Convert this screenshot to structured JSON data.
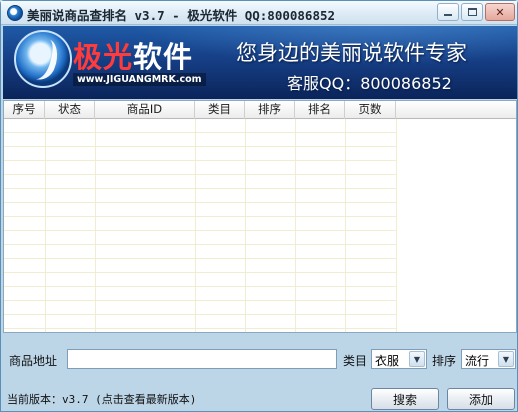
{
  "window": {
    "title": "美丽说商品查排名 v3.7 - 极光软件 QQ:800086852"
  },
  "banner": {
    "brand_part1": "极光",
    "brand_part2": "软件",
    "url": "www.JIGUANGMRK.com",
    "slogan": "您身边的美丽说软件专家",
    "service": "客服QQ：800086852"
  },
  "table": {
    "columns": [
      "序号",
      "状态",
      "商品ID",
      "类目",
      "排序",
      "排名",
      "页数"
    ],
    "rows": []
  },
  "form": {
    "product_url_label": "商品地址",
    "product_url_value": "",
    "category_label": "类目",
    "category_value": "衣服",
    "sort_label": "排序",
    "sort_value": "流行"
  },
  "footer": {
    "version_text": "当前版本：v3.7 (点击查看最新版本)",
    "search_label": "搜索",
    "add_label": "添加"
  },
  "colors": {
    "banner_top": "#1f5aa6",
    "banner_bottom": "#0b245a",
    "brand_red": "#ff3b3b",
    "grid_line": "#f1edd1",
    "window_bg": "#bcd6e8"
  }
}
